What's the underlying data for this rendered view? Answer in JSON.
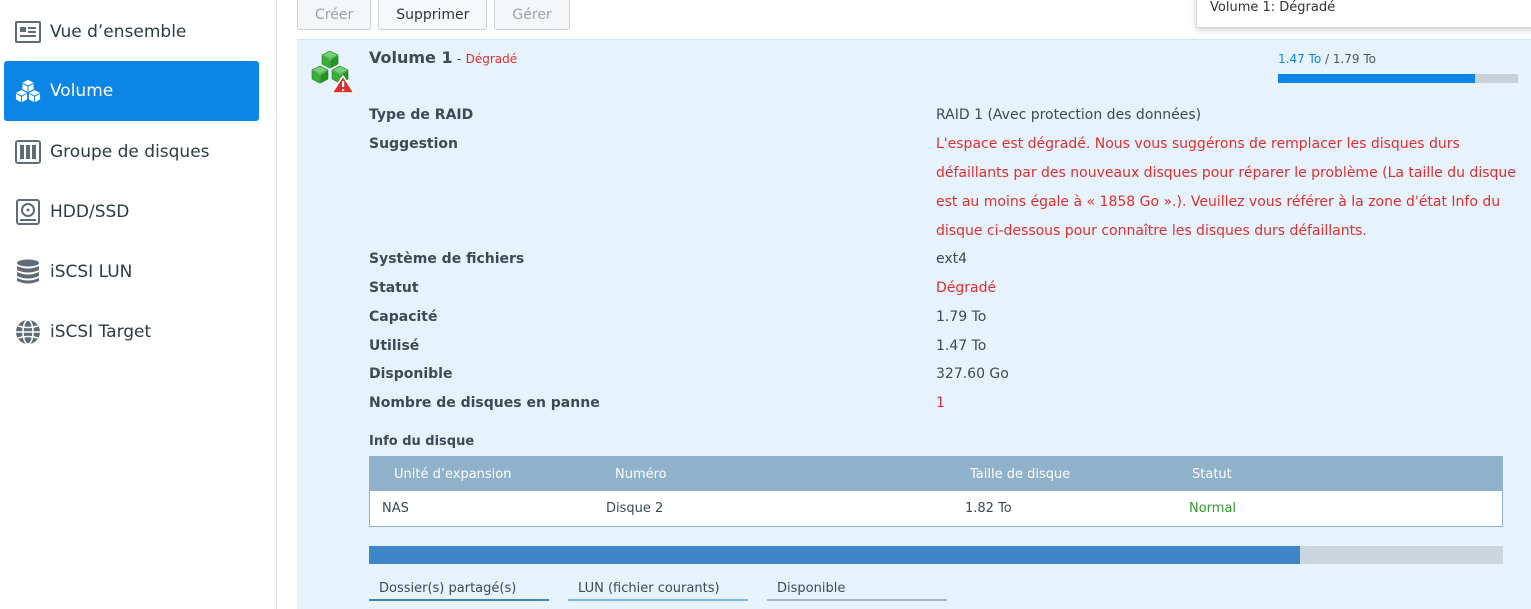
{
  "sidebar": {
    "items": [
      {
        "label": "Vue d’ensemble",
        "icon": "overview-icon",
        "active": false
      },
      {
        "label": "Volume",
        "icon": "volume-icon",
        "active": true
      },
      {
        "label": "Groupe de disques",
        "icon": "disk-group-icon",
        "active": false
      },
      {
        "label": "HDD/SSD",
        "icon": "hdd-icon",
        "active": false
      },
      {
        "label": "iSCSI LUN",
        "icon": "database-icon",
        "active": false
      },
      {
        "label": "iSCSI Target",
        "icon": "globe-icon",
        "active": false
      }
    ]
  },
  "toolbar": {
    "create_label": "Créer",
    "delete_label": "Supprimer",
    "manage_label": "Gérer"
  },
  "tooltip": {
    "text": "Volume 1: Dégradé"
  },
  "volume": {
    "name": "Volume 1",
    "separator": " - ",
    "status": "Dégradé",
    "usage_used": "1.47 To",
    "usage_sep": " / ",
    "usage_total": "1.79 To",
    "usage_fraction": 0.82,
    "details": [
      {
        "label": "Type de RAID",
        "value": "RAID 1 (Avec protection des données)",
        "red": false,
        "lines": 1
      },
      {
        "label": "Suggestion",
        "value": "L'espace est dégradé. Nous vous suggérons de remplacer les disques durs défaillants par des nouveaux disques pour réparer le problème (La taille du disque est au moins égale à « 1858 Go ».). Veuillez vous référer à la zone d'état Info du disque ci-dessous pour connaître les disques durs défaillants.",
        "red": true,
        "lines": 4
      },
      {
        "label": "Système de fichiers",
        "value": "ext4",
        "red": false,
        "lines": 1
      },
      {
        "label": "Statut",
        "value": "Dégradé",
        "red": true,
        "lines": 1
      },
      {
        "label": "Capacité",
        "value": "1.79 To",
        "red": false,
        "lines": 1
      },
      {
        "label": "Utilisé",
        "value": "1.47 To",
        "red": false,
        "lines": 1
      },
      {
        "label": "Disponible",
        "value": "327.60 Go",
        "red": false,
        "lines": 1
      },
      {
        "label": "Nombre de disques en panne",
        "value": "1",
        "red": true,
        "lines": 1
      }
    ]
  },
  "disk_info": {
    "heading": "Info du disque",
    "columns": [
      "Unité d’expansion",
      "Numéro",
      "Taille de disque",
      "Statut"
    ],
    "rows": [
      [
        "NAS",
        "Disque 2",
        "1.82 To",
        "Normal"
      ]
    ]
  },
  "storage": {
    "fill_fraction": 0.821,
    "legend": [
      "Dossier(s) partagé(s)",
      "LUN (fichier courants)",
      "Disponible"
    ]
  },
  "colors": {
    "accent": "#0c86e6",
    "danger": "#e02e2e",
    "ok": "#2d9a2d",
    "table_header": "#8fb1c9",
    "panel_bg": "#e6f3fc"
  }
}
